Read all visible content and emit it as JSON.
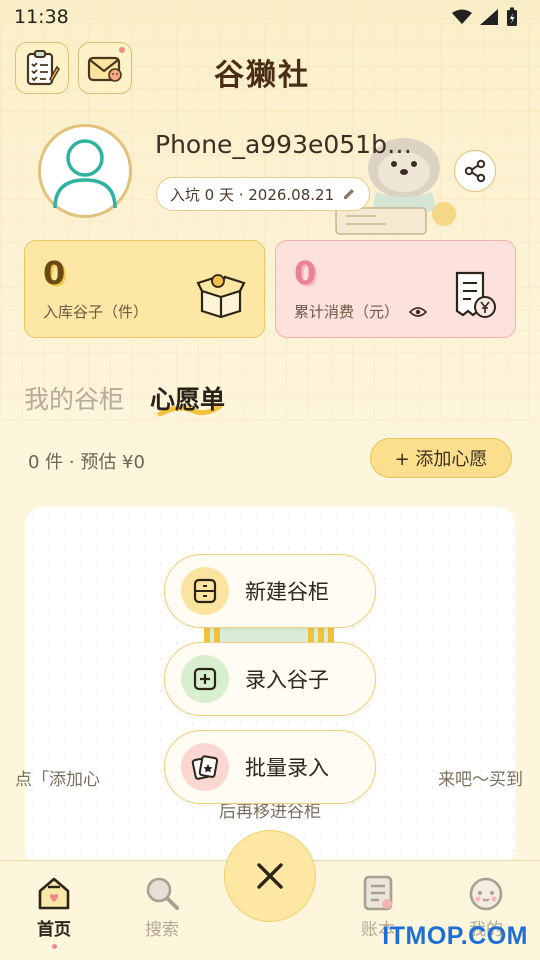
{
  "status_bar": {
    "time": "11:38"
  },
  "header": {
    "brand": "谷獭社"
  },
  "profile": {
    "username": "Phone_a993e051b8...",
    "join_info": "入坑 0 天 · 2026.08.21"
  },
  "stats": {
    "stored": {
      "value": "0",
      "label": "入库谷子（件）"
    },
    "spent": {
      "value": "0",
      "label": "累计消费（元）"
    }
  },
  "tabs": [
    {
      "label": "我的谷柜",
      "active": false
    },
    {
      "label": "心愿单",
      "active": true
    }
  ],
  "wishlist": {
    "summary": "0 件 · 预估 ¥0",
    "add_label": "+ 添加心愿",
    "empty_line1": "点「添加心",
    "empty_line1_end": "来吧～买到",
    "empty_line2": "后再移进谷柜"
  },
  "fab_menu": [
    {
      "label": "新建谷柜",
      "icon": "cabinet-icon",
      "color": "#fbe3a0"
    },
    {
      "label": "录入谷子",
      "icon": "plus-square-icon",
      "color": "#d7efcf"
    },
    {
      "label": "批量录入",
      "icon": "cards-icon",
      "color": "#fbd7d2"
    }
  ],
  "bottom_nav": [
    {
      "label": "首页",
      "icon": "home-icon",
      "active": true
    },
    {
      "label": "搜索",
      "icon": "search-icon",
      "active": false
    },
    {
      "label": "账本",
      "icon": "ledger-icon",
      "active": false
    },
    {
      "label": "我的",
      "icon": "face-icon",
      "active": false
    }
  ],
  "watermark": "ITMOP.COM"
}
